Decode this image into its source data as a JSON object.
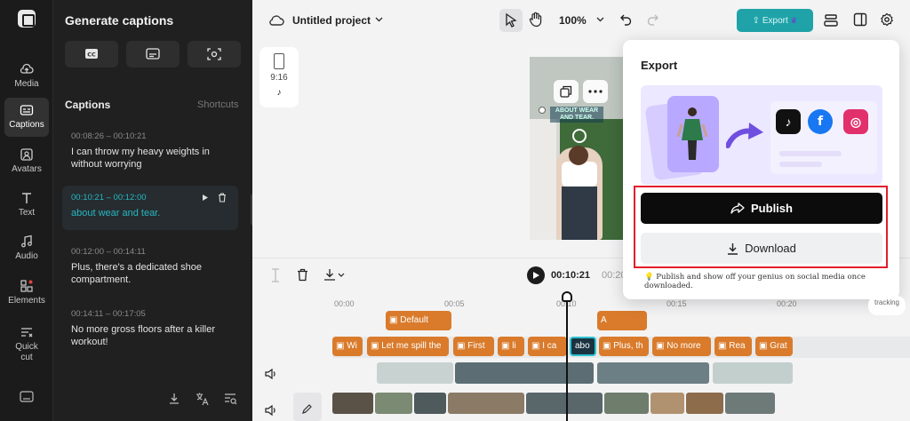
{
  "rail": {
    "items": [
      {
        "label": "Media",
        "icon": "cloud-upload-icon"
      },
      {
        "label": "Captions",
        "icon": "captions-icon"
      },
      {
        "label": "Avatars",
        "icon": "avatar-icon"
      },
      {
        "label": "Text",
        "icon": "text-icon"
      },
      {
        "label": "Audio",
        "icon": "music-note-icon"
      },
      {
        "label": "Elements",
        "icon": "elements-icon"
      },
      {
        "label": "Quick cut",
        "icon": "quick-cut-icon"
      }
    ],
    "active": "Captions"
  },
  "panel": {
    "title": "Generate captions",
    "section_title": "Captions",
    "shortcuts": "Shortcuts",
    "captions": [
      {
        "time": "00:08:26 – 00:10:21",
        "text": "I can throw my heavy weights in without worrying"
      },
      {
        "time": "00:10:21 – 00:12:00",
        "text": "about wear and tear."
      },
      {
        "time": "00:12:00 – 00:14:11",
        "text": "Plus, there's a dedicated shoe compartment."
      },
      {
        "time": "00:14:11 – 00:17:05",
        "text": "No more gross floors after a killer workout!"
      }
    ]
  },
  "topbar": {
    "project_title": "Untitled project",
    "zoom": "100%",
    "export": "Export"
  },
  "format": {
    "ratio": "9:16"
  },
  "preview": {
    "caption": "ABOUT WEAR AND TEAR."
  },
  "timeline": {
    "current": "00:10:21",
    "total": "00:20",
    "ruler": [
      "00:00",
      "00:05",
      "00:10",
      "00:15",
      "00:20"
    ],
    "text_clips": [
      "Default",
      "A"
    ],
    "caption_clips": [
      "Wi",
      "Let me spill the",
      "First",
      "li",
      "I ca",
      "abo",
      "Plus, th",
      "No more",
      "Rea",
      "Grat"
    ],
    "tracking": "tracking"
  },
  "export_popup": {
    "title": "Export",
    "publish": "Publish",
    "download": "Download",
    "note": "Publish and show off your genius on social media once downloaded.",
    "social": [
      "tiktok",
      "facebook",
      "instagram"
    ]
  },
  "colors": {
    "accent": "#1fa3a8",
    "caption_clip": "#d97b2b",
    "highlight_box": "#e31d2b",
    "active_caption": "#27b7c2"
  }
}
